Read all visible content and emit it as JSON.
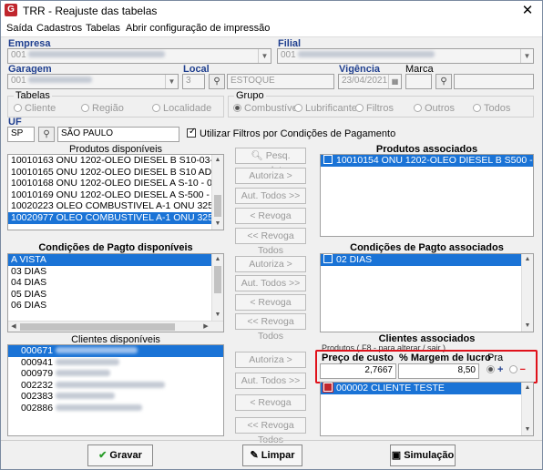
{
  "window": {
    "title": "TRR - Reajuste das tabelas",
    "close_glyph": "✕"
  },
  "menu": [
    "Saída",
    "Cadastros",
    "Tabelas",
    "Abrir configuração de impressão"
  ],
  "empresa": {
    "label": "Empresa",
    "value": "001"
  },
  "filial": {
    "label": "Filial",
    "value": "001"
  },
  "garagem": {
    "label": "Garagem",
    "value": "001"
  },
  "local": {
    "label": "Local",
    "value": "3",
    "name": "ESTOQUE"
  },
  "vigencia": {
    "label": "Vigência",
    "value": "23/04/2021"
  },
  "marca": {
    "label": "Marca",
    "value": ""
  },
  "tabelas": {
    "title": "Tabelas",
    "options": [
      "Cliente",
      "Região",
      "Localidade"
    ]
  },
  "grupo": {
    "title": "Grupo",
    "options": [
      "Combustível",
      "Lubrificante",
      "Filtros",
      "Outros",
      "Todos"
    ]
  },
  "uf": {
    "label": "UF",
    "code": "SP",
    "name": "SÃO PAULO"
  },
  "filtro_cond_pag": {
    "label": "Utilizar Filtros por Condições de Pagamento",
    "checked": true
  },
  "produtos_disponiveis": {
    "title": "Produtos disponíveis",
    "items": [
      "10010163  ONU 1202-OLEO DIESEL B S10-03-III",
      "10010165  ONU 1202-OLEO DIESEL B S10 ADITIVADO 0",
      "10010168  ONU 1202-OLEO DIESEL A S-10 - 03 -  III",
      "10010169  ONU 1202-OLEO DIESEL A S-500 - 03 - III",
      "10020223  OLEO COMBUSTIVEL A-1 ONU 3256 CL 3 III",
      "10020977  OLEO COMBUSTIVEL A-1 ONU 3256 CL 3 III"
    ],
    "selected_index": 5
  },
  "produtos_associados": {
    "title": "Produtos associados",
    "items": [
      "10010154  ONU 1202-OLEO DIESEL B S500 - 03 - III"
    ]
  },
  "cond_pagto_disponiveis": {
    "title": "Condições de Pagto disponíveis",
    "items": [
      "A VISTA",
      "03 DIAS",
      "04 DIAS",
      "05 DIAS",
      "06 DIAS"
    ],
    "selected_index": 0
  },
  "cond_pagto_associados": {
    "title": "Condições de Pagto associados",
    "items": [
      "02 DIAS"
    ]
  },
  "clientes_disponiveis": {
    "title": "Clientes disponíveis",
    "items": [
      "000671",
      "000941",
      "000979",
      "002232",
      "002383",
      "002886"
    ],
    "selected_index": 0
  },
  "clientes_associados": {
    "title": "Clientes associados",
    "hint": "Produtos ( F8 - para alterar / sair )",
    "items": [
      "000002  CLIENTE TESTE"
    ]
  },
  "precos": {
    "custo_label": "Preço de custo",
    "custo_value": "2,7667",
    "margem_label": "% Margem de lucro",
    "margem_value": "8,50",
    "pra_label": "Pra",
    "plus": "+",
    "minus": "−"
  },
  "buttons_produtos": [
    "Pesq. produto",
    "Autoriza >",
    "Aut. Todos >>",
    "< Revoga",
    "<< Revoga Todos"
  ],
  "buttons_cond": [
    "Autoriza >",
    "Aut. Todos >>",
    "< Revoga",
    "<< Revoga Todos"
  ],
  "buttons_clientes": [
    "Autoriza >",
    "Aut. Todos >>",
    "< Revoga",
    "<< Revoga Todos"
  ],
  "bottom": {
    "gravar": "Gravar",
    "limpar": "Limpar",
    "simulacao": "Simulação"
  },
  "colors": {
    "accent": "#1a73d6",
    "label_blue": "#1f3f8f",
    "highlight": "#e0121b"
  }
}
